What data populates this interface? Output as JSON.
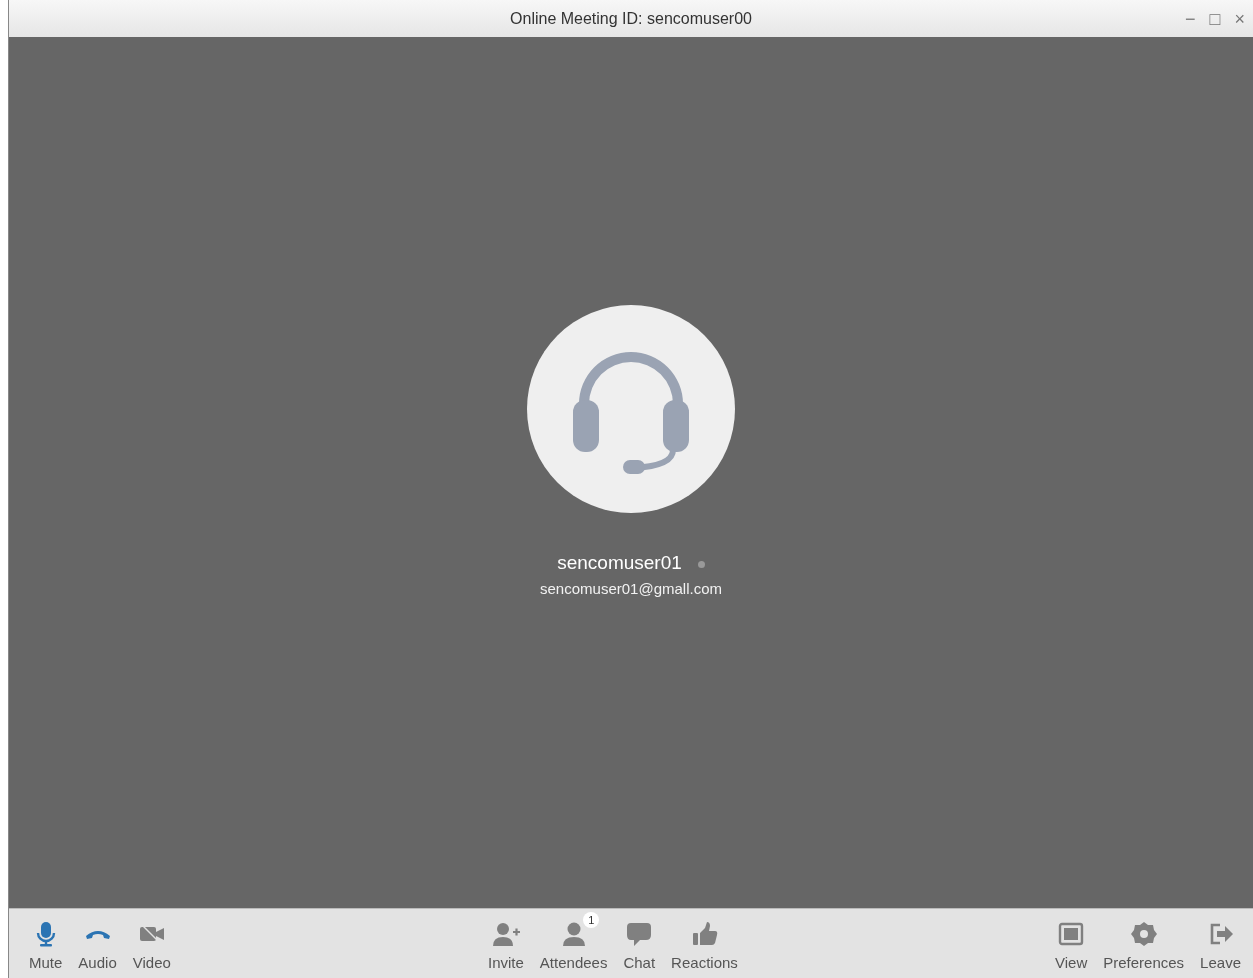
{
  "window": {
    "title": "Online Meeting ID: sencomuser00",
    "controls": [
      "−",
      "□",
      "×"
    ]
  },
  "participant": {
    "name": "sencomuser01",
    "email": "sencomuser01@gmall.com",
    "online": false
  },
  "toolbar": {
    "left": [
      {
        "label": "Mute",
        "kind": "mic",
        "active": true
      },
      {
        "label": "Audio",
        "kind": "phone",
        "active": true
      },
      {
        "label": "Video",
        "kind": "camera",
        "active": false
      }
    ],
    "center": [
      {
        "label": "Invite",
        "kind": "invite",
        "active": false
      },
      {
        "label": "Attendees",
        "kind": "attendees",
        "active": false,
        "badge": "1"
      },
      {
        "label": "Chat",
        "kind": "chat",
        "active": false
      },
      {
        "label": "Reactions",
        "kind": "reactions",
        "active": false
      }
    ],
    "right": [
      {
        "label": "View",
        "kind": "view",
        "active": false
      },
      {
        "label": "Preferences",
        "kind": "preferences",
        "active": false
      },
      {
        "label": "Leave",
        "kind": "leave",
        "active": false
      }
    ]
  }
}
